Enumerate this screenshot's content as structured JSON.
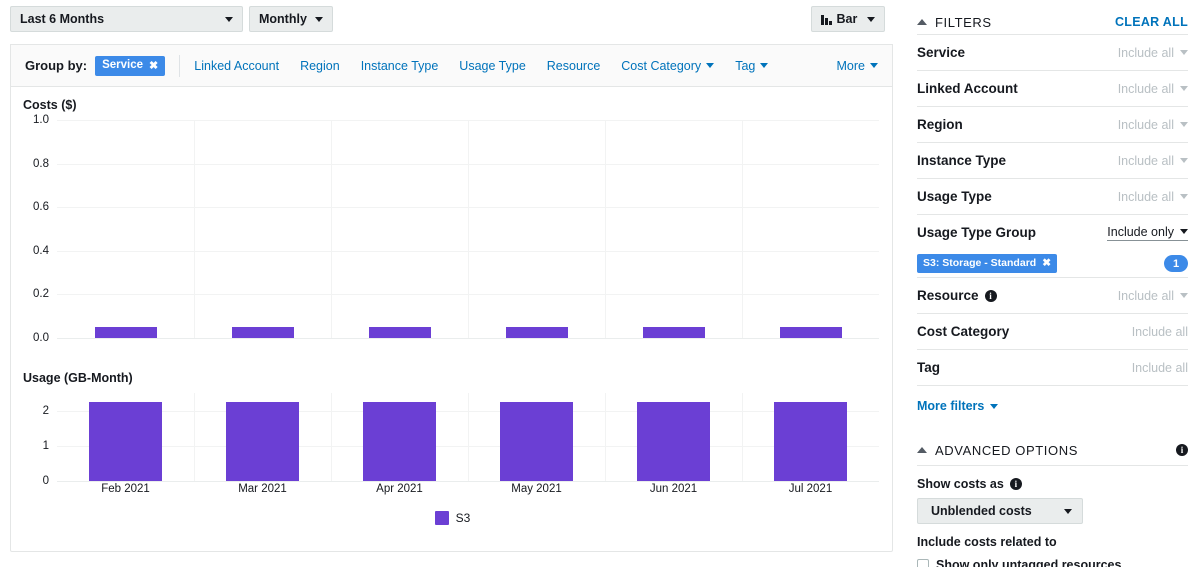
{
  "toolbar": {
    "date_range": "Last 6 Months",
    "granularity": "Monthly",
    "chart_type": "Bar",
    "chart_type_icon": "bar-chart-icon"
  },
  "group_by": {
    "label": "Group by:",
    "selected_chip": "Service",
    "chip_remove_icon": "close-icon",
    "options": [
      {
        "label": "Linked Account",
        "has_caret": false
      },
      {
        "label": "Region",
        "has_caret": false
      },
      {
        "label": "Instance Type",
        "has_caret": false
      },
      {
        "label": "Usage Type",
        "has_caret": false
      },
      {
        "label": "Resource",
        "has_caret": false
      },
      {
        "label": "Cost Category",
        "has_caret": true
      },
      {
        "label": "Tag",
        "has_caret": true
      }
    ],
    "more_label": "More"
  },
  "chart_data": [
    {
      "type": "bar",
      "title": "Costs ($)",
      "xlabel": "",
      "ylabel": "Costs ($)",
      "categories": [
        "Feb 2021",
        "Mar 2021",
        "Apr 2021",
        "May 2021",
        "Jun 2021",
        "Jul 2021"
      ],
      "series": [
        {
          "name": "S3",
          "color": "#6b3fd4",
          "values": [
            0.05,
            0.05,
            0.05,
            0.05,
            0.05,
            0.05
          ]
        }
      ],
      "ylim": [
        0.0,
        1.0
      ],
      "yticks": [
        "1.0",
        "0.8",
        "0.6",
        "0.4",
        "0.2",
        "0.0"
      ],
      "ytick_values": [
        1.0,
        0.8,
        0.6,
        0.4,
        0.2,
        0.0
      ],
      "grid": true,
      "legend": [
        "S3"
      ],
      "legend_position": "bottom"
    },
    {
      "type": "bar",
      "title": "Usage (GB-Month)",
      "xlabel": "",
      "ylabel": "Usage (GB-Month)",
      "categories": [
        "Feb 2021",
        "Mar 2021",
        "Apr 2021",
        "May 2021",
        "Jun 2021",
        "Jul 2021"
      ],
      "series": [
        {
          "name": "S3",
          "color": "#6b3fd4",
          "values": [
            2.25,
            2.25,
            2.25,
            2.25,
            2.25,
            2.25
          ]
        }
      ],
      "ylim": [
        0,
        2.5
      ],
      "yticks": [
        "2",
        "1",
        "0"
      ],
      "ytick_values": [
        2,
        1,
        0
      ],
      "grid": true,
      "legend": [
        "S3"
      ],
      "legend_position": "bottom"
    }
  ],
  "filters": {
    "title": "FILTERS",
    "collapse_icon": "triangle-up-icon",
    "clear_all": "CLEAR ALL",
    "rows": [
      {
        "name": "Service",
        "value": "Include all",
        "active": false,
        "info": false,
        "caret": true
      },
      {
        "name": "Linked Account",
        "value": "Include all",
        "active": false,
        "info": false,
        "caret": true
      },
      {
        "name": "Region",
        "value": "Include all",
        "active": false,
        "info": false,
        "caret": true
      },
      {
        "name": "Instance Type",
        "value": "Include all",
        "active": false,
        "info": false,
        "caret": true
      },
      {
        "name": "Usage Type",
        "value": "Include all",
        "active": false,
        "info": false,
        "caret": true
      },
      {
        "name": "Usage Type Group",
        "value": "Include only",
        "active": true,
        "info": false,
        "caret": true
      },
      {
        "name": "Resource",
        "value": "Include all",
        "active": false,
        "info": true,
        "caret": true
      },
      {
        "name": "Cost Category",
        "value": "Include all",
        "active": false,
        "info": false,
        "caret": false
      },
      {
        "name": "Tag",
        "value": "Include all",
        "active": false,
        "info": false,
        "caret": false
      }
    ],
    "selected_tag": "S3: Storage - Standard",
    "selected_tag_remove_icon": "close-icon",
    "selected_count": "1",
    "more_filters": "More filters"
  },
  "advanced": {
    "title": "ADVANCED OPTIONS",
    "collapse_icon": "triangle-up-icon",
    "info_icon": "info-icon",
    "show_costs_as_label": "Show costs as",
    "show_costs_as_value": "Unblended costs",
    "include_costs_label": "Include costs related to",
    "untagged_checkbox_label": "Show only untagged resources"
  },
  "colors": {
    "accent_blue": "#0073bb",
    "chip_blue": "#3c8ae8",
    "series_purple": "#6b3fd4"
  }
}
